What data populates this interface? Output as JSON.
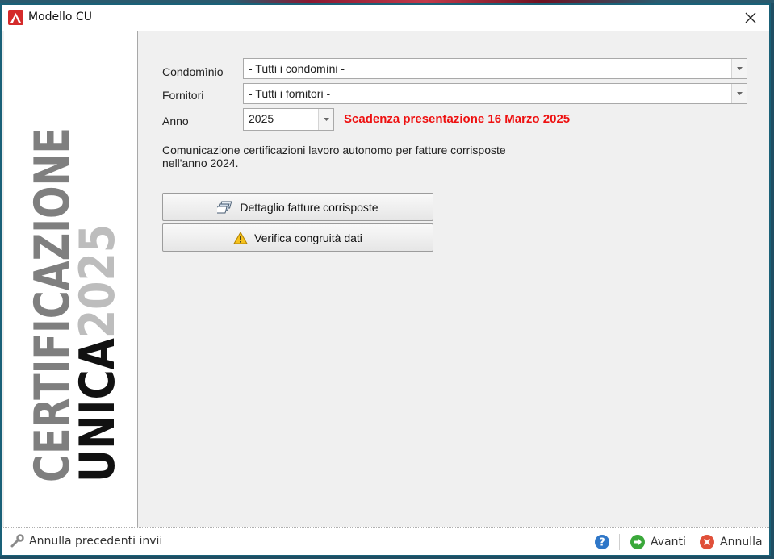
{
  "window": {
    "title": "Modello CU"
  },
  "brand": {
    "line1": "CERTIFICAZIONE",
    "line2": "UNICA",
    "year": "2025"
  },
  "form": {
    "condominio_label": "Condomìnio",
    "condominio_value": "- Tutti i condomìni -",
    "fornitori_label": "Fornitori",
    "fornitori_value": "- Tutti i fornitori -",
    "anno_label": "Anno",
    "anno_value": "2025",
    "deadline": "Scadenza presentazione 16 Marzo 2025",
    "description_line1": "Comunicazione certificazioni lavoro autonomo per fatture corrisposte",
    "description_line2": "nell'anno 2024."
  },
  "buttons": {
    "dettaglio": "Dettaglio fatture corrisposte",
    "verifica": "Verifica congruità dati"
  },
  "statusbar": {
    "annulla_precedenti": "Annulla precedenti invii",
    "avanti": "Avanti",
    "annulla": "Annulla"
  },
  "colors": {
    "deadline": "#ee1111",
    "app_icon": "#d42a2a",
    "brand_gray": "#7f7f7f",
    "brand_dark": "#111111",
    "brand_year": "#bdbdbd"
  },
  "icons": {
    "app": "app-logo-icon",
    "close": "close-icon",
    "invoices": "invoices-icon",
    "warning": "warning-icon",
    "help": "help-icon",
    "next": "next-arrow-icon",
    "cancel": "cancel-icon",
    "wrench": "wrench-icon"
  }
}
